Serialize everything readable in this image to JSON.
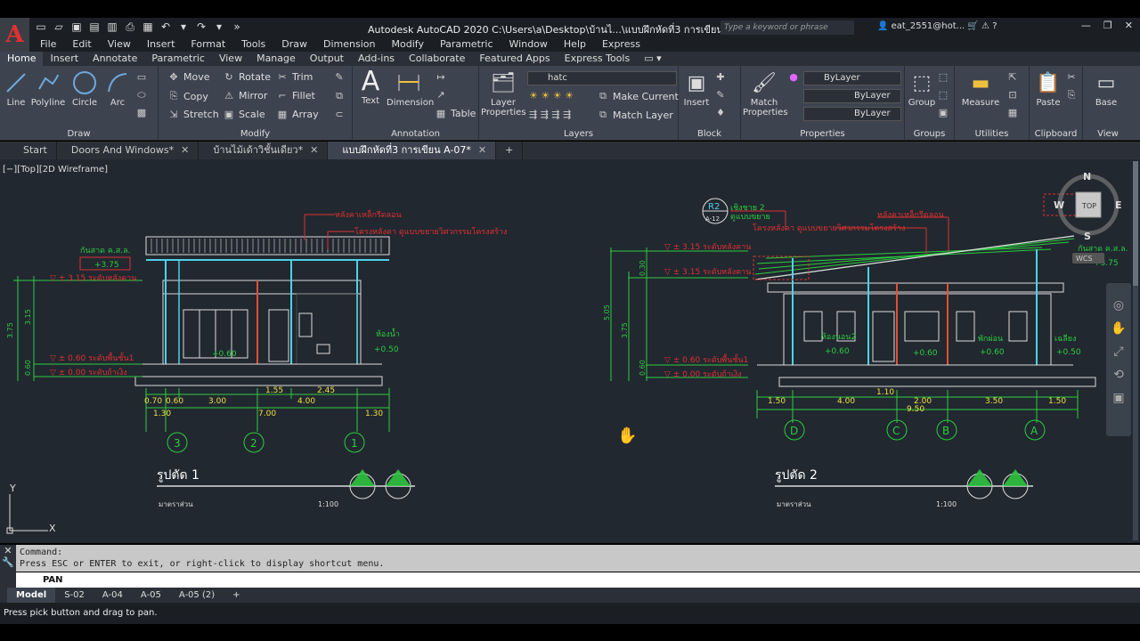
{
  "app": {
    "logo": "A",
    "title": "Autodesk AutoCAD 2020   C:\\Users\\a\\Desktop\\บ้านไ...\\แบบฝึกหัดที่3 การเขียน A-07.dwg",
    "search_placeholder": "Type a keyword or phrase",
    "user": "eat_2551@hot..."
  },
  "menus": [
    "File",
    "Edit",
    "View",
    "Insert",
    "Format",
    "Tools",
    "Draw",
    "Dimension",
    "Modify",
    "Parametric",
    "Window",
    "Help",
    "Express"
  ],
  "ribbon_tabs": [
    "Home",
    "Insert",
    "Annotate",
    "Parametric",
    "View",
    "Manage",
    "Output",
    "Add-ins",
    "Collaborate",
    "Featured Apps",
    "Express Tools"
  ],
  "panels": {
    "draw": {
      "title": "Draw",
      "line": "Line",
      "polyline": "Polyline",
      "circle": "Circle",
      "arc": "Arc"
    },
    "modify": {
      "title": "Modify",
      "move": "Move",
      "rotate": "Rotate",
      "trim": "Trim",
      "copy": "Copy",
      "mirror": "Mirror",
      "fillet": "Fillet",
      "stretch": "Stretch",
      "scale": "Scale",
      "array": "Array"
    },
    "annotation": {
      "title": "Annotation",
      "text": "Text",
      "dimension": "Dimension",
      "table": "Table"
    },
    "layers": {
      "title": "Layers",
      "layer_properties": "Layer Properties",
      "current_layer": "hatc",
      "make_current": "Make Current",
      "match_layer": "Match Layer"
    },
    "block": {
      "title": "Block",
      "insert": "Insert"
    },
    "properties": {
      "title": "Properties",
      "match": "Match Properties",
      "color": "ByLayer",
      "linetype": "ByLayer",
      "lineweight": "ByLayer"
    },
    "groups": {
      "title": "Groups",
      "group": "Group"
    },
    "utilities": {
      "title": "Utilities",
      "measure": "Measure"
    },
    "clipboard": {
      "title": "Clipboard",
      "paste": "Paste"
    },
    "view": {
      "title": "View",
      "base": "Base"
    }
  },
  "doc_tabs": [
    "Start",
    "Doors And Windows*",
    "บ้านไม้เด้าวิชั้นเดียว*",
    "แบบฝึกหัดที่3 การเขียน A-07*"
  ],
  "viewport_label": "[−][Top][2D Wireframe]",
  "viewcube": {
    "n": "N",
    "s": "S",
    "w": "W",
    "e": "E",
    "top": "TOP",
    "wcs": "WCS"
  },
  "drawing": {
    "section1": {
      "title": "รูปตัด 1",
      "scale_label": "มาตราส่วน",
      "scale": "1:100",
      "axes": [
        "3",
        "2",
        "1"
      ],
      "dims_top": [
        "0.70",
        "0.60",
        "3.00",
        "1.55",
        "4.00",
        "2.45"
      ],
      "dims_total": "7.00",
      "dims_edge": [
        "1.30",
        "1.30"
      ],
      "notes": {
        "roof": "หลังคาเหล็กรีดลอน",
        "structure": "โครงหลังคา ดูแบบขยายวิศวกรรมโครงสร้าง",
        "eave": "กันสาด ค.ส.ล.",
        "eave_level": "+3.75",
        "beam_level": "▽ ± 3.15 ระดับหลังคาน",
        "floor_level": "▽ ± 0.60 ระดับพื้นชั้น1",
        "ground_level": "▽ ± 0.00 ระดับถ้าเงิง",
        "room": "ห้องน้ำ",
        "room_level": "+0.50",
        "room2_level": "+0.60",
        "vdim1": "3.75",
        "vdim2": "3.15",
        "vdim3": "0.60"
      }
    },
    "section2": {
      "title": "รูปตัด 2",
      "scale_label": "มาตราส่วน",
      "scale": "1:100",
      "axes": [
        "D",
        "C",
        "B",
        "A"
      ],
      "dims": [
        "1.50",
        "4.00",
        "1.10",
        "2.00",
        "3.50",
        "1.50"
      ],
      "dims_total": "9.50",
      "notes": {
        "ref": "R2",
        "ref_sheet": "A-12",
        "ref_text": "เชิงชาย 2",
        "ref_sub": "ดูแบบขยาย",
        "roof": "หลังคาเหล็กรีดลอน",
        "structure": "โครงหลังคา ดูแบบขยายวิศวกรรมโครงสร้าง",
        "eave": "กันสาด ค.ส.ล.",
        "eave_level": "+3.75",
        "roof_level": "▽ ± 3.15 ระดับหลังคาน",
        "beam_level": "▽ ± 3.15 ระดับหลังคาน",
        "floor_level": "▽ ± 0.60 ระดับพื้นชั้น1",
        "ground_level": "▽ ± 0.00 ระดับถ้าเงิง",
        "room_a": "ห้องนอน2",
        "room_b": "พักผ่อน",
        "room_c": "เฉลียง",
        "l1": "+0.60",
        "l2": "+0.60",
        "l3": "+0.60",
        "l4": "+0.50",
        "vdim1": "5.05",
        "vdim2": "3.75",
        "vdim3": "0.30",
        "vdim4": "0.60"
      }
    }
  },
  "ucs": {
    "y": "Y",
    "x": "X"
  },
  "command": {
    "line1": "Command:",
    "line2": "Press ESC or ENTER to exit, or right-click to display shortcut menu.",
    "input": "PAN"
  },
  "layout_tabs": [
    "Model",
    "S-02",
    "A-04",
    "A-05",
    "A-05 (2)",
    "+"
  ],
  "status": "Press pick button and drag to pan."
}
